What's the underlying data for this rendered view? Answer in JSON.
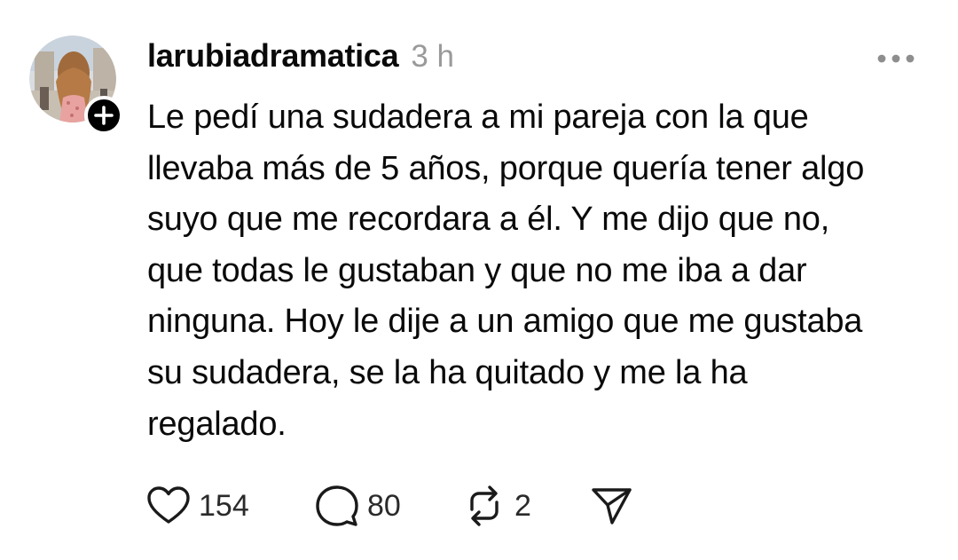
{
  "post": {
    "username": "larubiadramatica",
    "timestamp": "3 h",
    "text_lines": [
      "Le pedí una sudadera a mi pareja con la que",
      "llevaba más de 5 años, porque quería tener algo",
      "suyo que me recordara a él. Y me dijo que no,",
      "que todas le gustaban y que no me iba a dar",
      "ninguna. Hoy le dije a un amigo que me gustaba",
      "su sudadera, se la ha quitado y me la ha",
      "regalado."
    ]
  },
  "actions": {
    "likes": "154",
    "comments": "80",
    "reposts": "2"
  },
  "icons": {
    "avatar": "avatar-photo",
    "follow": "plus-icon",
    "more": "more-dots-icon",
    "like": "heart-icon",
    "comment": "speech-bubble-icon",
    "repost": "repost-icon",
    "share": "send-icon"
  },
  "colors": {
    "text": "#0a0a0a",
    "muted": "#9a9a9a",
    "badge": "#000000"
  }
}
